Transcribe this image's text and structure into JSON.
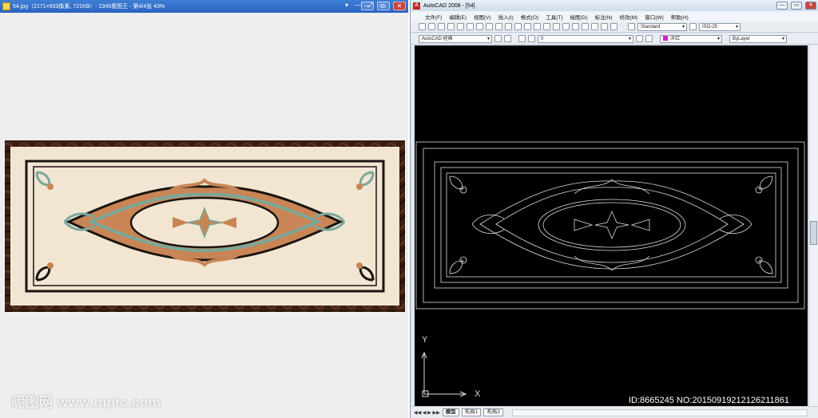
{
  "viewer": {
    "title": "54.jpg（2171×933像素, 721KB）- 2345看图王 - 第4/4张 43%",
    "icon": "image-viewer-icon",
    "controls": [
      "▾",
      "—",
      "⤢",
      "▭"
    ],
    "window_buttons": [
      "—",
      "▭",
      "✕"
    ]
  },
  "cad": {
    "title": "AutoCAD 2008 - [54]",
    "icon_text": "A",
    "window_buttons": [
      "—",
      "▭",
      "✕"
    ],
    "menu": [
      "文件(F)",
      "编辑(E)",
      "视图(V)",
      "插入(I)",
      "格式(O)",
      "工具(T)",
      "绘图(D)",
      "标注(N)",
      "修改(M)",
      "窗口(W)",
      "帮助(H)"
    ],
    "text_style": "Standard",
    "dim_style": "ISO-25",
    "workspace": "AutoCAD 经典",
    "layer": "0",
    "color": "洋红",
    "color_hex": "#d020d0",
    "linetype": "ByLayer",
    "axis_y": "Y",
    "axis_x": "X",
    "tabs": [
      "模型",
      "布局1",
      "布局2"
    ],
    "tab_nav": "◀◀ ◀ ▶ ▶▶",
    "canvas_color": "#000000",
    "line_color": "#dcdcdc"
  },
  "watermark_left": "昵图网 www.nipic.com",
  "watermark_id": "ID:8665245 NO:20150919212126211861",
  "colors": {
    "border_dark": "#2a140c",
    "field": "#f2e6d3",
    "terracotta": "#c98556",
    "teal": "#7aa89a",
    "black_inlay": "#1a1410"
  }
}
